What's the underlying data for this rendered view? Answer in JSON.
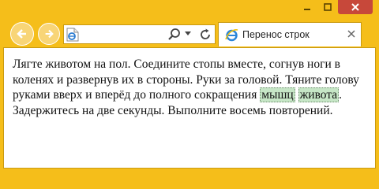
{
  "browser": {
    "tab": {
      "title": "Перенос строк"
    },
    "address": {
      "value": ""
    },
    "icons": {
      "minimize": "minimize-icon",
      "maximize": "maximize-icon",
      "close": "close-icon",
      "back": "back-arrow-icon",
      "forward": "forward-arrow-icon",
      "page": "ie-page-icon",
      "search": "search-icon",
      "dropdown": "chevron-down-icon",
      "refresh": "refresh-icon",
      "tab_close": "close-icon"
    },
    "colors": {
      "frame": "#f5be1a",
      "close_button": "#c7483a",
      "highlight": "#c6e6c6"
    }
  },
  "content": {
    "text_before": "Лягте животом на пол. Соедините стопы вместе, согнув ноги в коленях и развернув их в стороны. Руки за головой. Тяните голову руками вверх и вперёд до полного сокращения ",
    "highlight_line1": "мышц",
    "highlight_line2": "живота",
    "text_after": ". Задержитесь на две секунды. Выполните восемь повторений."
  }
}
